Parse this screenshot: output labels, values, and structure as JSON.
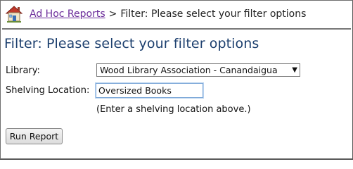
{
  "breadcrumb": {
    "home_icon": "house-icon",
    "link_label": "Ad Hoc Reports",
    "separator": ">",
    "current": "Filter: Please select your filter options"
  },
  "page": {
    "title": "Filter: Please select your filter options"
  },
  "form": {
    "library_label": "Library:",
    "library_value": "Wood Library Association - Canandaigua",
    "shelving_label": "Shelving Location:",
    "shelving_value": "Oversized Books",
    "shelving_hint": "(Enter a shelving location above.)",
    "run_button_label": "Run Report"
  },
  "colors": {
    "link": "#6b2c9a",
    "title": "#1c3f6e",
    "divider": "#777777"
  }
}
